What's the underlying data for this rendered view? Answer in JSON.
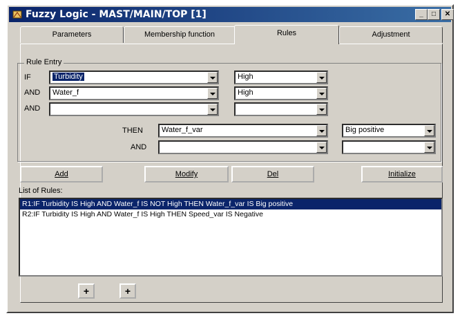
{
  "window": {
    "title": "Fuzzy Logic - MAST/MAIN/TOP [1]",
    "min": "_",
    "max": "□",
    "close": "✕"
  },
  "tabs": [
    {
      "label": "Parameters"
    },
    {
      "label": "Membership function"
    },
    {
      "label": "Rules"
    },
    {
      "label": "Adjustment"
    }
  ],
  "rule_entry": {
    "title": "Rule Entry",
    "if_label": "IF",
    "and1_label": "AND",
    "and2_label": "AND",
    "then_label": "THEN",
    "and_then_label": "AND",
    "if_var": "Turbidity",
    "if_val": "High",
    "and1_var": "Water_f",
    "and1_val": "High",
    "and2_var": "",
    "and2_val": "",
    "then_var": "Water_f_var",
    "then_val": "Big positive",
    "and_then_var": "",
    "and_then_val": ""
  },
  "buttons": {
    "add": "Add",
    "modify": "Modify",
    "del": "Del",
    "initialize": "Initialize"
  },
  "rules": {
    "label": "List of Rules:",
    "items": [
      "R1:IF Turbidity IS High AND Water_f IS NOT High THEN Water_f_var IS Big positive",
      "R2:IF Turbidity IS High AND Water_f IS High THEN Speed_var IS Negative"
    ]
  },
  "move_buttons": {
    "up": "+",
    "down": "+"
  }
}
